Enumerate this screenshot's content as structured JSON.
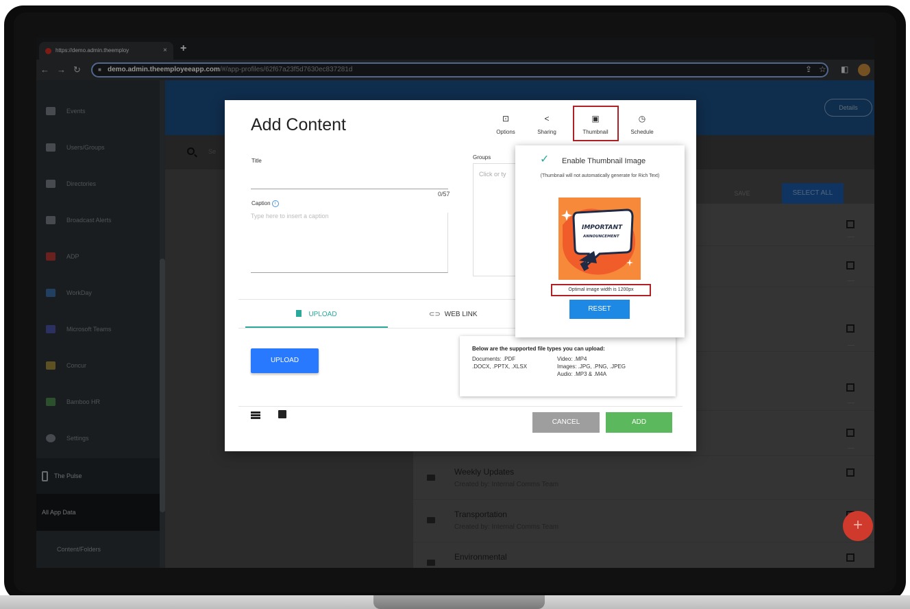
{
  "browser": {
    "tab_title": "https://demo.admin.theemploy",
    "tab_close": "×",
    "new_tab": "+",
    "url_host": "demo.admin.theemployeeapp.com",
    "url_path": "/#/app-profiles/62f67a23f5d7630ec837281d"
  },
  "sidebar": {
    "items": [
      {
        "label": "Events"
      },
      {
        "label": "Users/Groups"
      },
      {
        "label": "Directories"
      },
      {
        "label": "Broadcast Alerts"
      },
      {
        "label": "ADP"
      },
      {
        "label": "WorkDay"
      },
      {
        "label": "Microsoft Teams"
      },
      {
        "label": "Concur"
      },
      {
        "label": "Bamboo HR"
      },
      {
        "label": "Settings"
      }
    ],
    "pulse": "The Pulse",
    "all_app_data": "All App Data",
    "content_folders": "Content/Folders"
  },
  "header": {
    "details": "Details"
  },
  "search": {
    "placeholder": "Se"
  },
  "toolbar": {
    "save": "SAVE",
    "select_all": "SELECT ALL"
  },
  "list": {
    "rows": [
      {
        "title": "",
        "sub": ""
      },
      {
        "title": "",
        "sub": ""
      },
      {
        "title": "",
        "sub": ""
      },
      {
        "title": "",
        "sub": ""
      },
      {
        "title": "",
        "sub": ""
      },
      {
        "title": "Weekly Updates",
        "sub": "Created by: Internal Comms Team"
      },
      {
        "title": "Transportation",
        "sub": "Created by: Internal Comms Team"
      },
      {
        "title": "Environmental",
        "sub": ""
      }
    ]
  },
  "fab": "+",
  "modal": {
    "title": "Add Content",
    "tools": {
      "options": "Options",
      "sharing": "Sharing",
      "thumbnail": "Thumbnail",
      "schedule": "Schedule"
    },
    "title_label": "Title",
    "title_value": "",
    "counter": "0/57",
    "caption_label": "Caption",
    "caption_placeholder": "Type here to insert a caption",
    "groups_label": "Groups",
    "groups_placeholder": "Click or ty",
    "tab_upload": "UPLOAD",
    "tab_weblink": "WEB LINK",
    "upload_button": "UPLOAD",
    "filetypes": {
      "heading": "Below are the supported file types you can upload:",
      "left": [
        "Documents: .PDF",
        ".DOCX, .PPTX, .XLSX"
      ],
      "right": [
        "Video: .MP4",
        "Images: .JPG, .PNG, .JPEG",
        "Audio: .MP3 & .M4A"
      ]
    },
    "cancel": "CANCEL",
    "add": "ADD"
  },
  "thumbnail_popover": {
    "enable_label": "Enable Thumbnail Image",
    "note": "(Thumbnail will not automatically generate for Rich Text)",
    "image_text_1": "IMPORTANT",
    "image_text_2": "ANNOUNCEMENT",
    "hint": "Optimal image width is 1200px",
    "reset": "RESET"
  }
}
